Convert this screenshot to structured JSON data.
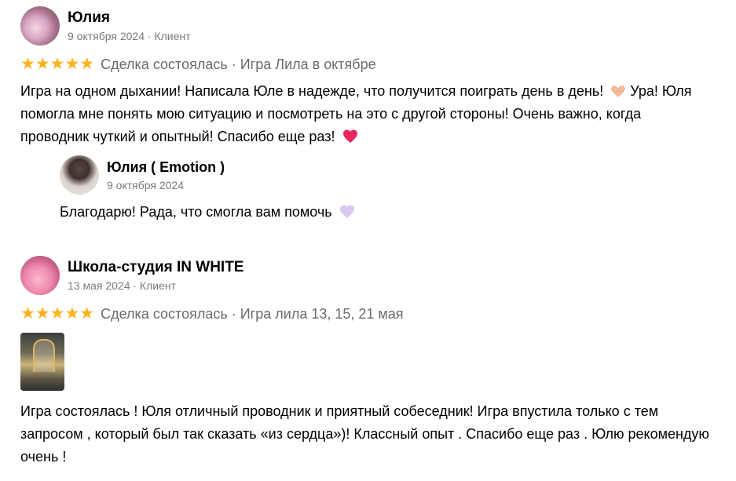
{
  "reviews": [
    {
      "author": "Юлия",
      "meta": "9 октября 2024 · Клиент",
      "stars": "★★★★★",
      "rating": 5,
      "deal": "Сделка состоялась · Игра Лила в октябре",
      "text_a": "Игра на одном дыхании! Написала Юле в надежде, что получится поиграть день в день! ",
      "text_b": " Ура! Юля помогла мне понять мою ситуацию и посмотреть на это с другой стороны! Очень важно, когда проводник чуткий и опытный! Спасибо еще раз! ",
      "reply": {
        "author": "Юлия ( Emotion )",
        "date": "9 октября 2024",
        "text": "Благодарю! Рада, что смогла вам помочь "
      }
    },
    {
      "author": "Школа-студия IN WHITE",
      "meta": "13 мая 2024 · Клиент",
      "stars": "★★★★★",
      "rating": 5,
      "deal": "Сделка состоялась · Игра лила 13, 15, 21 мая",
      "text": "Игра состоялась ! Юля отличный проводник и приятный собеседник! Игра впустила только с тем запросом , который был так сказать «из сердца»)! Классный опыт . Спасибо еще раз . Юлю рекомендую очень !"
    }
  ],
  "colors": {
    "star": "#ffb21e",
    "meta": "#7a7a7a",
    "heart": "#e8265e",
    "light_heart": "#d9c8f0"
  },
  "icons": [
    "heart-hands-icon",
    "red-heart-icon",
    "light-purple-heart-icon"
  ]
}
